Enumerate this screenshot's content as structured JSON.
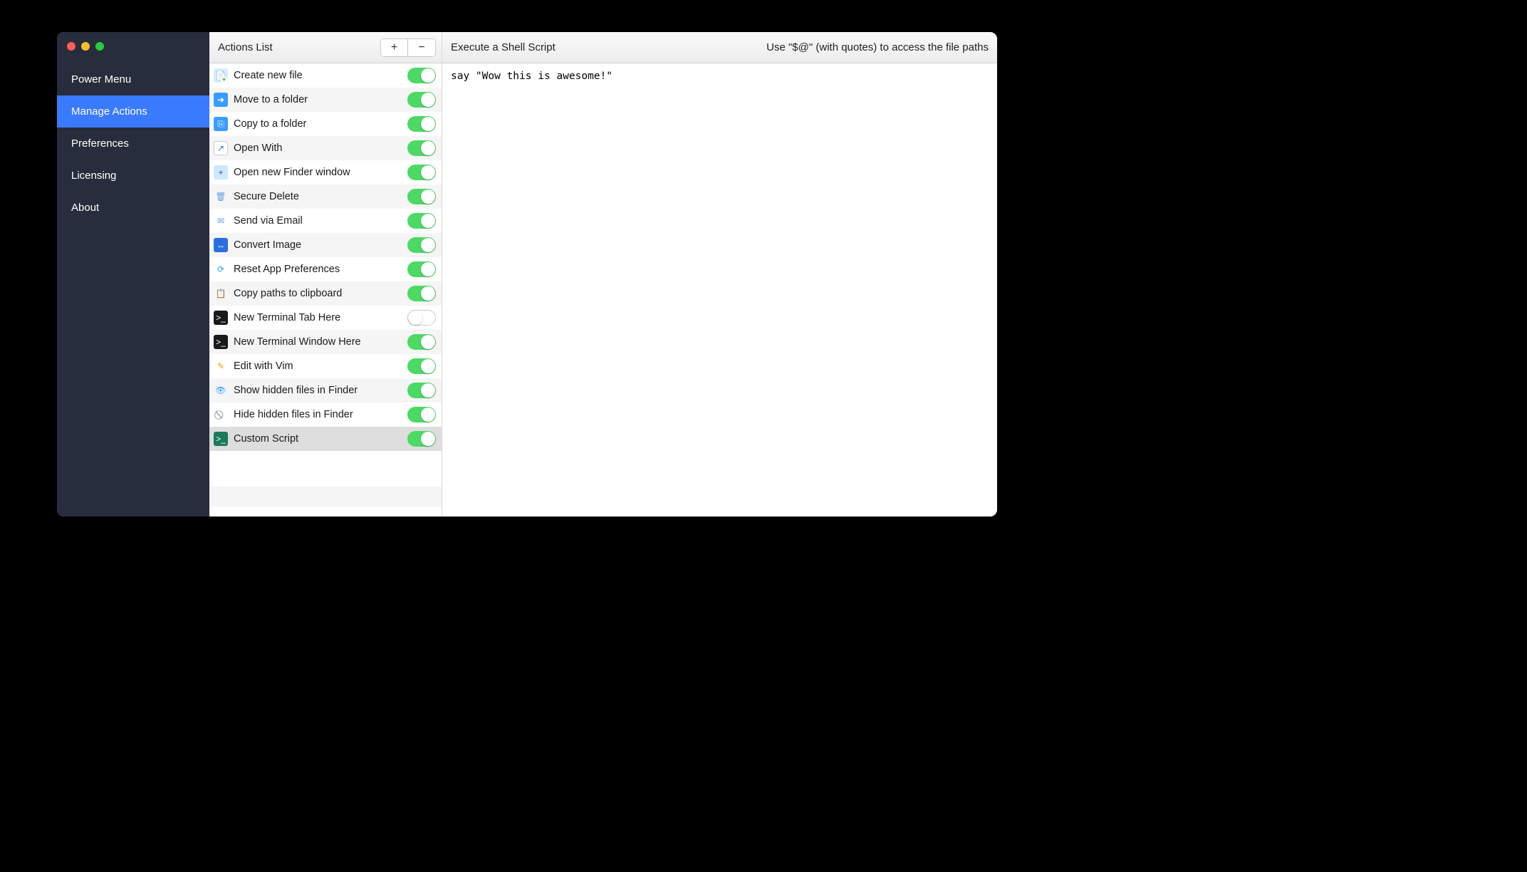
{
  "sidebar": {
    "items": [
      {
        "label": "Power Menu",
        "selected": false
      },
      {
        "label": "Manage Actions",
        "selected": true
      },
      {
        "label": "Preferences",
        "selected": false
      },
      {
        "label": "Licensing",
        "selected": false
      },
      {
        "label": "About",
        "selected": false
      }
    ]
  },
  "actions": {
    "title": "Actions List",
    "add_label": "+",
    "remove_label": "−",
    "items": [
      {
        "label": "Create new file",
        "enabled": true,
        "icon": "newfile",
        "glyph": "📄"
      },
      {
        "label": "Move to a folder",
        "enabled": true,
        "icon": "move",
        "glyph": "➜"
      },
      {
        "label": "Copy to a folder",
        "enabled": true,
        "icon": "copy",
        "glyph": "⎘"
      },
      {
        "label": "Open With",
        "enabled": true,
        "icon": "openwith",
        "glyph": "↗"
      },
      {
        "label": "Open new Finder window",
        "enabled": true,
        "icon": "finder",
        "glyph": "+"
      },
      {
        "label": "Secure Delete",
        "enabled": true,
        "icon": "trash",
        "glyph": "🗑"
      },
      {
        "label": "Send via Email",
        "enabled": true,
        "icon": "email",
        "glyph": "✉"
      },
      {
        "label": "Convert Image",
        "enabled": true,
        "icon": "convert",
        "glyph": "↔"
      },
      {
        "label": "Reset App Preferences",
        "enabled": true,
        "icon": "reset",
        "glyph": "⟳"
      },
      {
        "label": "Copy paths to clipboard",
        "enabled": true,
        "icon": "clipboard",
        "glyph": "📋"
      },
      {
        "label": "New Terminal Tab Here",
        "enabled": false,
        "icon": "term",
        "glyph": ">_"
      },
      {
        "label": "New Terminal Window Here",
        "enabled": true,
        "icon": "term",
        "glyph": ">_"
      },
      {
        "label": "Edit with Vim",
        "enabled": true,
        "icon": "vim",
        "glyph": "✎"
      },
      {
        "label": "Show hidden files in Finder",
        "enabled": true,
        "icon": "eye",
        "glyph": "👁"
      },
      {
        "label": "Hide hidden files in Finder",
        "enabled": true,
        "icon": "eyeoff",
        "glyph": "⃠"
      },
      {
        "label": "Custom Script",
        "enabled": true,
        "icon": "script",
        "glyph": ">_",
        "selected": true
      }
    ]
  },
  "editor": {
    "title": "Execute a Shell Script",
    "hint": "Use \"$@\" (with quotes) to access the file paths",
    "content": "say \"Wow this is awesome!\""
  }
}
